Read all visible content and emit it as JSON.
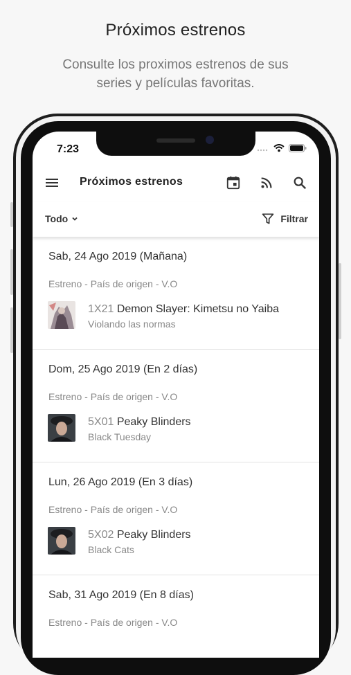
{
  "promo": {
    "title": "Próximos estrenos",
    "subtitle": "Consulte los proximos estrenos de sus series y películas favoritas."
  },
  "status_bar": {
    "time": "7:23"
  },
  "app_bar": {
    "title": "Próximos estrenos",
    "icons": [
      "menu-icon",
      "calendar-icon",
      "rss-icon",
      "search-icon"
    ]
  },
  "filter_bar": {
    "dropdown_value": "Todo",
    "filter_label": "Filtrar"
  },
  "days": [
    {
      "date": "Sab, 24 Ago 2019 (Mañana)",
      "origin": "Estreno - País de origen - V.O",
      "code": "1X21",
      "series": "Demon Slayer: Kimetsu no Yaiba",
      "episode": "Violando las normas"
    },
    {
      "date": "Dom, 25 Ago 2019 (En 2 días)",
      "origin": "Estreno - País de origen - V.O",
      "code": "5X01",
      "series": "Peaky Blinders",
      "episode": "Black Tuesday"
    },
    {
      "date": "Lun, 26 Ago 2019 (En 3 días)",
      "origin": "Estreno - País de origen - V.O",
      "code": "5X02",
      "series": "Peaky Blinders",
      "episode": "Black Cats"
    },
    {
      "date": "Sab, 31 Ago 2019 (En 8 días)",
      "origin": "Estreno - País de origen - V.O",
      "code": "",
      "series": "",
      "episode": ""
    }
  ]
}
